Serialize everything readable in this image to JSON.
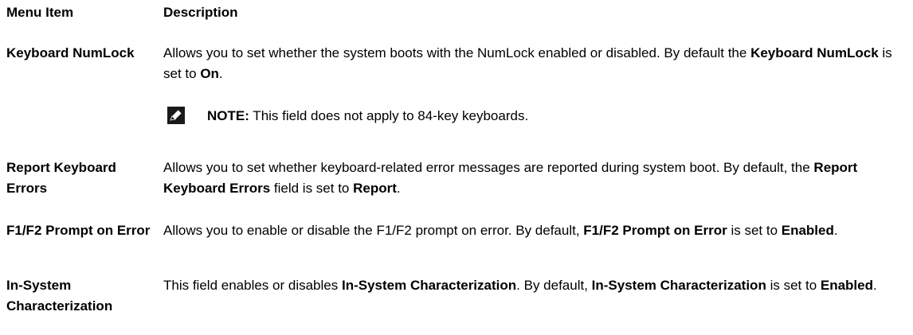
{
  "header": {
    "col1": "Menu Item",
    "col2": "Description"
  },
  "rows": [
    {
      "label": "Keyboard NumLock",
      "desc": [
        {
          "t": "Allows you to set whether the system boots with the NumLock enabled or disabled. By default the ",
          "b": false
        },
        {
          "t": "Keyboard NumLock",
          "b": true
        },
        {
          "t": " is set to ",
          "b": false
        },
        {
          "t": "On",
          "b": true
        },
        {
          "t": ".",
          "b": false
        }
      ],
      "note": {
        "icon": "pencil-note-icon",
        "label": "NOTE:",
        "text": " This field does not apply to 84-key keyboards."
      }
    },
    {
      "label": "Report Keyboard Errors",
      "desc": [
        {
          "t": "Allows you to set whether keyboard-related error messages are reported during system boot. By default, the ",
          "b": false
        },
        {
          "t": "Report Keyboard Errors",
          "b": true
        },
        {
          "t": " field is set to ",
          "b": false
        },
        {
          "t": "Report",
          "b": true
        },
        {
          "t": ".",
          "b": false
        }
      ]
    },
    {
      "label": "F1/F2 Prompt on Error",
      "desc": [
        {
          "t": "Allows you to enable or disable the F1/F2 prompt on error. By default, ",
          "b": false
        },
        {
          "t": "F1/F2 Prompt on Error",
          "b": true
        },
        {
          "t": " is set to ",
          "b": false
        },
        {
          "t": "Enabled",
          "b": true
        },
        {
          "t": ".",
          "b": false
        }
      ]
    },
    {
      "label": "In-System Characterization",
      "desc": [
        {
          "t": "This field enables or disables ",
          "b": false
        },
        {
          "t": "In-System Characterization",
          "b": true
        },
        {
          "t": ". By default, ",
          "b": false
        },
        {
          "t": "In-System Characterization",
          "b": true
        },
        {
          "t": " is set to ",
          "b": false
        },
        {
          "t": "Enabled",
          "b": true
        },
        {
          "t": ".",
          "b": false
        }
      ]
    }
  ]
}
